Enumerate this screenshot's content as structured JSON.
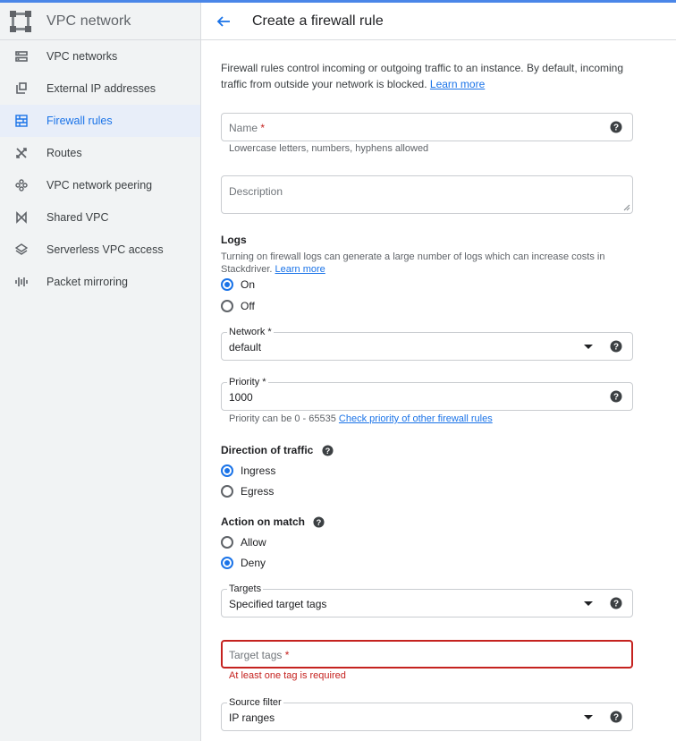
{
  "sidebar": {
    "title": "VPC network",
    "items": [
      {
        "label": "VPC networks",
        "icon": "vpc-networks-icon"
      },
      {
        "label": "External IP addresses",
        "icon": "external-ip-icon"
      },
      {
        "label": "Firewall rules",
        "icon": "firewall-icon",
        "active": true
      },
      {
        "label": "Routes",
        "icon": "routes-icon"
      },
      {
        "label": "VPC network peering",
        "icon": "peering-icon"
      },
      {
        "label": "Shared VPC",
        "icon": "shared-vpc-icon"
      },
      {
        "label": "Serverless VPC access",
        "icon": "serverless-vpc-icon"
      },
      {
        "label": "Packet mirroring",
        "icon": "packet-mirroring-icon"
      }
    ]
  },
  "header": {
    "title": "Create a firewall rule"
  },
  "intro": {
    "text": "Firewall rules control incoming or outgoing traffic to an instance. By default, incoming traffic from outside your network is blocked.",
    "learn_more": "Learn more"
  },
  "name_field": {
    "placeholder": "Name",
    "required_mark": "*",
    "hint": "Lowercase letters, numbers, hyphens allowed"
  },
  "description_field": {
    "placeholder": "Description"
  },
  "logs": {
    "title": "Logs",
    "text": "Turning on firewall logs can generate a large number of logs which can increase costs in Stackdriver.",
    "learn_more": "Learn more",
    "options": [
      "On",
      "Off"
    ],
    "selected": "On"
  },
  "network": {
    "label": "Network *",
    "value": "default"
  },
  "priority": {
    "label": "Priority *",
    "value": "1000",
    "hint": "Priority can be 0 - 65535",
    "hint_link": "Check priority of other firewall rules"
  },
  "direction": {
    "title": "Direction of traffic",
    "options": [
      "Ingress",
      "Egress"
    ],
    "selected": "Ingress"
  },
  "action": {
    "title": "Action on match",
    "options": [
      "Allow",
      "Deny"
    ],
    "selected": "Deny"
  },
  "targets": {
    "label": "Targets",
    "value": "Specified target tags"
  },
  "target_tags": {
    "placeholder": "Target tags",
    "required_mark": "*",
    "error": "At least one tag is required"
  },
  "source_filter": {
    "label": "Source filter",
    "value": "IP ranges"
  },
  "colors": {
    "accent": "#1a73e8",
    "error": "#c5221f",
    "active_bg": "#e8eef9",
    "sidebar_bg": "#f1f3f4",
    "topline": "#4a86e8"
  }
}
